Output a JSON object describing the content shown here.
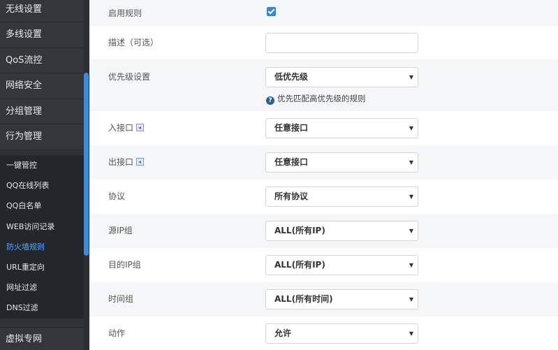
{
  "sidebar": {
    "main_items": [
      "无线设置",
      "多线设置",
      "QoS流控",
      "网络安全",
      "分组管理",
      "行为管理"
    ],
    "sub_items": [
      "一键管控",
      "QQ在线列表",
      "QQ白名单",
      "WEB访问记录",
      "防火墙规则",
      "URL重定向",
      "网址过滤",
      "DNS过滤"
    ],
    "active_sub": "防火墙规则",
    "bottom_item": "虚拟专网"
  },
  "form": {
    "enable_rule": {
      "label": "启用规则",
      "checked": true
    },
    "description": {
      "label": "描述（可选）",
      "value": ""
    },
    "priority": {
      "label": "优先级设置",
      "value": "低优先级",
      "hint": "优先匹配高优先级的规则"
    },
    "in_port": {
      "label": "入接口",
      "value": "任意接口"
    },
    "out_port": {
      "label": "出接口",
      "value": "任意接口"
    },
    "protocol": {
      "label": "协议",
      "value": "所有协议"
    },
    "src_ip_group": {
      "label": "源IP组",
      "value": "ALL(所有IP)"
    },
    "dst_ip_group": {
      "label": "目的IP组",
      "value": "ALL(所有IP)"
    },
    "time_group": {
      "label": "时间组",
      "value": "ALL(所有时间)"
    },
    "action": {
      "label": "动作",
      "value": "允许"
    }
  },
  "icons": {
    "select_caret": "▼",
    "help": "?"
  },
  "colors": {
    "sidebar_bg": "#2f3338",
    "accent": "#3a86d4",
    "active_text": "#5aa6ff",
    "alt_row": "#f5f6f7"
  }
}
